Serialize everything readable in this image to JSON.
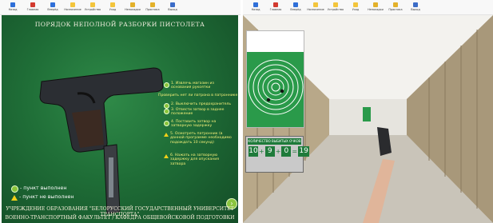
{
  "toolbar": {
    "buttons": [
      "Назад",
      "Главная",
      "Вперёд",
      "Назначение",
      "Устройство",
      "Уход",
      "Неполадки",
      "Практика",
      "Выход"
    ],
    "colors": [
      "#2f6fd8",
      "#d23a2f",
      "#2f6fd8",
      "#f3c53c",
      "#f3c53c",
      "#f3c53c",
      "#e3b12a",
      "#e3b12a",
      "#3b6cc7"
    ]
  },
  "left": {
    "title": "ПОРЯДОК НЕПОЛНОЙ РАЗБОРКИ ПИСТОЛЕТА",
    "steps": [
      {
        "num": "1",
        "text": "1. Извлечь магазин из основания рукоятки"
      },
      {
        "num": "",
        "text": "Проверить нет ли патрона в патроннике"
      },
      {
        "num": "2",
        "text": "2. Выключить предохранитель"
      },
      {
        "num": "3",
        "text": "3. Отвести затвор в заднее положение"
      },
      {
        "num": "4",
        "text": "4. Поставить затвор на затворную задержку"
      },
      {
        "num": "5",
        "text": "5. Осмотреть патронник (в данной программе необходимо подождать 10 секунд)"
      },
      {
        "num": "6",
        "text": "6. Нажать на затворную задержку для опускания затвора"
      }
    ],
    "legend": [
      "- пункт выполнен",
      "- пункт не выполнен"
    ],
    "footer": [
      "УЧРЕЖДЕНИЕ ОБРАЗОВАНИЯ \"БЕЛОРУССКИЙ ГОСУДАРСТВЕННЫЙ УНИВЕРСИТЕТ ТРАНСПОРТА\"",
      "ВОЕННО-ТРАНСПОРТНЫЙ ФАКУЛЬТЕТ / КАФЕДРА ОБЩЕВОЙСКОВОЙ ПОДГОТОВКИ"
    ]
  },
  "right": {
    "score_title": "КОЛИЧЕСТВО ВЫБИТЫХ ОЧКОВ",
    "scores": [
      "10",
      "9",
      "0"
    ],
    "ops": [
      "+",
      "+",
      "="
    ],
    "total": "19"
  },
  "colors": {
    "left_bg": "#1f6e37",
    "accent_yellow": "#f5f07a",
    "target_green": "#2a9a4a"
  }
}
